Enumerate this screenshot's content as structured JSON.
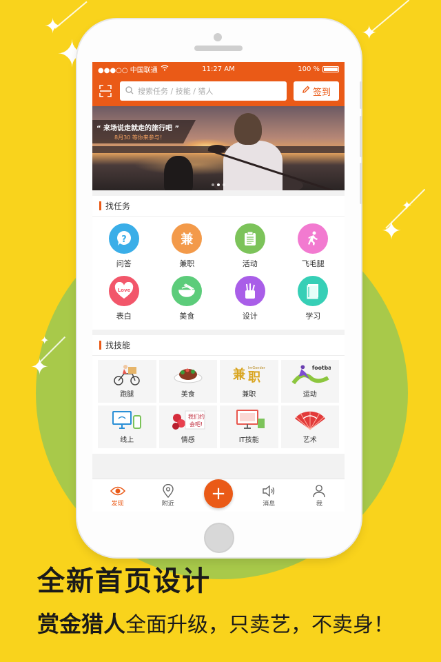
{
  "colors": {
    "background": "#f9d31c",
    "accent_circle": "#a8c94a",
    "brand_orange": "#ea5a17"
  },
  "status_bar": {
    "carrier": "●●●○○ 中国联通",
    "time": "11:27 AM",
    "battery": "100 %"
  },
  "header": {
    "search_placeholder": "搜索任务 / 技能 / 猎人",
    "sign_in_label": "签到"
  },
  "banner": {
    "caption_title": "“ 来场说走就走的旅行吧 ”",
    "caption_sub": "8月30 等你来参与！",
    "active_dot": 1,
    "dot_count": 3
  },
  "find_tasks": {
    "title": "找任务",
    "items": [
      {
        "label": "问答",
        "icon": "question-icon",
        "color": "#3aaee8"
      },
      {
        "label": "兼职",
        "icon": "part-time-icon",
        "color": "#f39a4a"
      },
      {
        "label": "活动",
        "icon": "clipboard-icon",
        "color": "#7cc35a"
      },
      {
        "label": "飞毛腿",
        "icon": "running-man-icon",
        "color": "#f27ad0"
      },
      {
        "label": "表白",
        "icon": "love-heart-icon",
        "color": "#f2566a"
      },
      {
        "label": "美食",
        "icon": "food-bowl-icon",
        "color": "#5ccc7a"
      },
      {
        "label": "设计",
        "icon": "pen-cup-icon",
        "color": "#a95ee8"
      },
      {
        "label": "学习",
        "icon": "book-icon",
        "color": "#36cfb6"
      }
    ]
  },
  "find_skills": {
    "title": "找技能",
    "items": [
      {
        "label": "跑腿",
        "icon": "delivery-bike-icon"
      },
      {
        "label": "美食",
        "icon": "dish-icon"
      },
      {
        "label": "兼职",
        "icon": "part-time-text-icon"
      },
      {
        "label": "运动",
        "icon": "football-player-icon"
      },
      {
        "label": "线上",
        "icon": "online-devices-icon"
      },
      {
        "label": "情感",
        "icon": "flowers-card-icon"
      },
      {
        "label": "IT技能",
        "icon": "computer-icon"
      },
      {
        "label": "艺术",
        "icon": "fan-icon"
      }
    ]
  },
  "tabbar": {
    "tabs": [
      {
        "label": "发现",
        "icon": "eye-icon",
        "active": true
      },
      {
        "label": "附近",
        "icon": "location-pin-icon",
        "active": false
      },
      {
        "label": "",
        "icon": "plus-icon",
        "active": false
      },
      {
        "label": "消息",
        "icon": "speaker-icon",
        "active": false
      },
      {
        "label": "我",
        "icon": "person-icon",
        "active": false
      }
    ],
    "fab_symbol": "+"
  },
  "promo": {
    "headline": "全新首页设计",
    "sub_bold": "赏金猎人",
    "sub_rest": "全面升级，只卖艺，不卖身！"
  }
}
